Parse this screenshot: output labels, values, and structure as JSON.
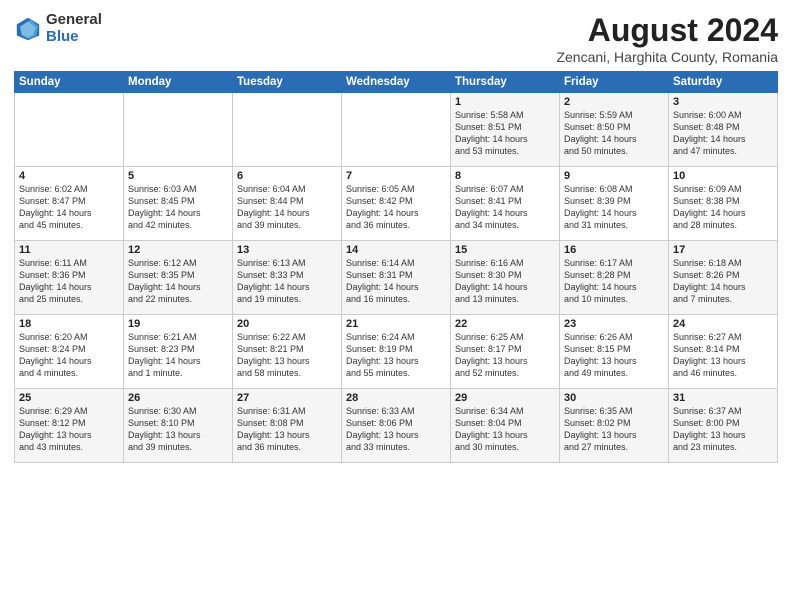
{
  "header": {
    "logo_general": "General",
    "logo_blue": "Blue",
    "main_title": "August 2024",
    "subtitle": "Zencani, Harghita County, Romania"
  },
  "weekdays": [
    "Sunday",
    "Monday",
    "Tuesday",
    "Wednesday",
    "Thursday",
    "Friday",
    "Saturday"
  ],
  "weeks": [
    [
      {
        "num": "",
        "info": ""
      },
      {
        "num": "",
        "info": ""
      },
      {
        "num": "",
        "info": ""
      },
      {
        "num": "",
        "info": ""
      },
      {
        "num": "1",
        "info": "Sunrise: 5:58 AM\nSunset: 8:51 PM\nDaylight: 14 hours\nand 53 minutes."
      },
      {
        "num": "2",
        "info": "Sunrise: 5:59 AM\nSunset: 8:50 PM\nDaylight: 14 hours\nand 50 minutes."
      },
      {
        "num": "3",
        "info": "Sunrise: 6:00 AM\nSunset: 8:48 PM\nDaylight: 14 hours\nand 47 minutes."
      }
    ],
    [
      {
        "num": "4",
        "info": "Sunrise: 6:02 AM\nSunset: 8:47 PM\nDaylight: 14 hours\nand 45 minutes."
      },
      {
        "num": "5",
        "info": "Sunrise: 6:03 AM\nSunset: 8:45 PM\nDaylight: 14 hours\nand 42 minutes."
      },
      {
        "num": "6",
        "info": "Sunrise: 6:04 AM\nSunset: 8:44 PM\nDaylight: 14 hours\nand 39 minutes."
      },
      {
        "num": "7",
        "info": "Sunrise: 6:05 AM\nSunset: 8:42 PM\nDaylight: 14 hours\nand 36 minutes."
      },
      {
        "num": "8",
        "info": "Sunrise: 6:07 AM\nSunset: 8:41 PM\nDaylight: 14 hours\nand 34 minutes."
      },
      {
        "num": "9",
        "info": "Sunrise: 6:08 AM\nSunset: 8:39 PM\nDaylight: 14 hours\nand 31 minutes."
      },
      {
        "num": "10",
        "info": "Sunrise: 6:09 AM\nSunset: 8:38 PM\nDaylight: 14 hours\nand 28 minutes."
      }
    ],
    [
      {
        "num": "11",
        "info": "Sunrise: 6:11 AM\nSunset: 8:36 PM\nDaylight: 14 hours\nand 25 minutes."
      },
      {
        "num": "12",
        "info": "Sunrise: 6:12 AM\nSunset: 8:35 PM\nDaylight: 14 hours\nand 22 minutes."
      },
      {
        "num": "13",
        "info": "Sunrise: 6:13 AM\nSunset: 8:33 PM\nDaylight: 14 hours\nand 19 minutes."
      },
      {
        "num": "14",
        "info": "Sunrise: 6:14 AM\nSunset: 8:31 PM\nDaylight: 14 hours\nand 16 minutes."
      },
      {
        "num": "15",
        "info": "Sunrise: 6:16 AM\nSunset: 8:30 PM\nDaylight: 14 hours\nand 13 minutes."
      },
      {
        "num": "16",
        "info": "Sunrise: 6:17 AM\nSunset: 8:28 PM\nDaylight: 14 hours\nand 10 minutes."
      },
      {
        "num": "17",
        "info": "Sunrise: 6:18 AM\nSunset: 8:26 PM\nDaylight: 14 hours\nand 7 minutes."
      }
    ],
    [
      {
        "num": "18",
        "info": "Sunrise: 6:20 AM\nSunset: 8:24 PM\nDaylight: 14 hours\nand 4 minutes."
      },
      {
        "num": "19",
        "info": "Sunrise: 6:21 AM\nSunset: 8:23 PM\nDaylight: 14 hours\nand 1 minute."
      },
      {
        "num": "20",
        "info": "Sunrise: 6:22 AM\nSunset: 8:21 PM\nDaylight: 13 hours\nand 58 minutes."
      },
      {
        "num": "21",
        "info": "Sunrise: 6:24 AM\nSunset: 8:19 PM\nDaylight: 13 hours\nand 55 minutes."
      },
      {
        "num": "22",
        "info": "Sunrise: 6:25 AM\nSunset: 8:17 PM\nDaylight: 13 hours\nand 52 minutes."
      },
      {
        "num": "23",
        "info": "Sunrise: 6:26 AM\nSunset: 8:15 PM\nDaylight: 13 hours\nand 49 minutes."
      },
      {
        "num": "24",
        "info": "Sunrise: 6:27 AM\nSunset: 8:14 PM\nDaylight: 13 hours\nand 46 minutes."
      }
    ],
    [
      {
        "num": "25",
        "info": "Sunrise: 6:29 AM\nSunset: 8:12 PM\nDaylight: 13 hours\nand 43 minutes."
      },
      {
        "num": "26",
        "info": "Sunrise: 6:30 AM\nSunset: 8:10 PM\nDaylight: 13 hours\nand 39 minutes."
      },
      {
        "num": "27",
        "info": "Sunrise: 6:31 AM\nSunset: 8:08 PM\nDaylight: 13 hours\nand 36 minutes."
      },
      {
        "num": "28",
        "info": "Sunrise: 6:33 AM\nSunset: 8:06 PM\nDaylight: 13 hours\nand 33 minutes."
      },
      {
        "num": "29",
        "info": "Sunrise: 6:34 AM\nSunset: 8:04 PM\nDaylight: 13 hours\nand 30 minutes."
      },
      {
        "num": "30",
        "info": "Sunrise: 6:35 AM\nSunset: 8:02 PM\nDaylight: 13 hours\nand 27 minutes."
      },
      {
        "num": "31",
        "info": "Sunrise: 6:37 AM\nSunset: 8:00 PM\nDaylight: 13 hours\nand 23 minutes."
      }
    ]
  ]
}
